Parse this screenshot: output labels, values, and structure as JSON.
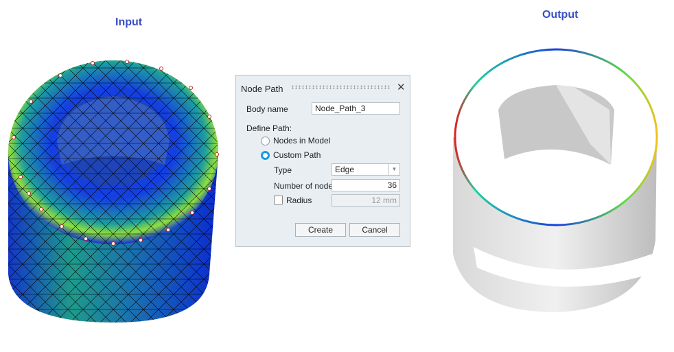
{
  "labels": {
    "input": "Input",
    "output": "Output"
  },
  "dialog": {
    "title": "Node Path",
    "close_icon": "close-icon",
    "body_name_label": "Body name",
    "body_name_value": "Node_Path_3",
    "define_path_label": "Define Path:",
    "option_nodes_in_model": "Nodes in Model",
    "option_custom_path": "Custom Path",
    "selected_option": "Custom Path",
    "type_label": "Type",
    "type_value": "Edge",
    "num_nodes_label": "Number of nodes",
    "num_nodes_value": "36",
    "radius_label": "Radius",
    "radius_checked": false,
    "radius_value": "12 mm",
    "create_label": "Create",
    "cancel_label": "Cancel",
    "accent": "#1a9be0"
  }
}
